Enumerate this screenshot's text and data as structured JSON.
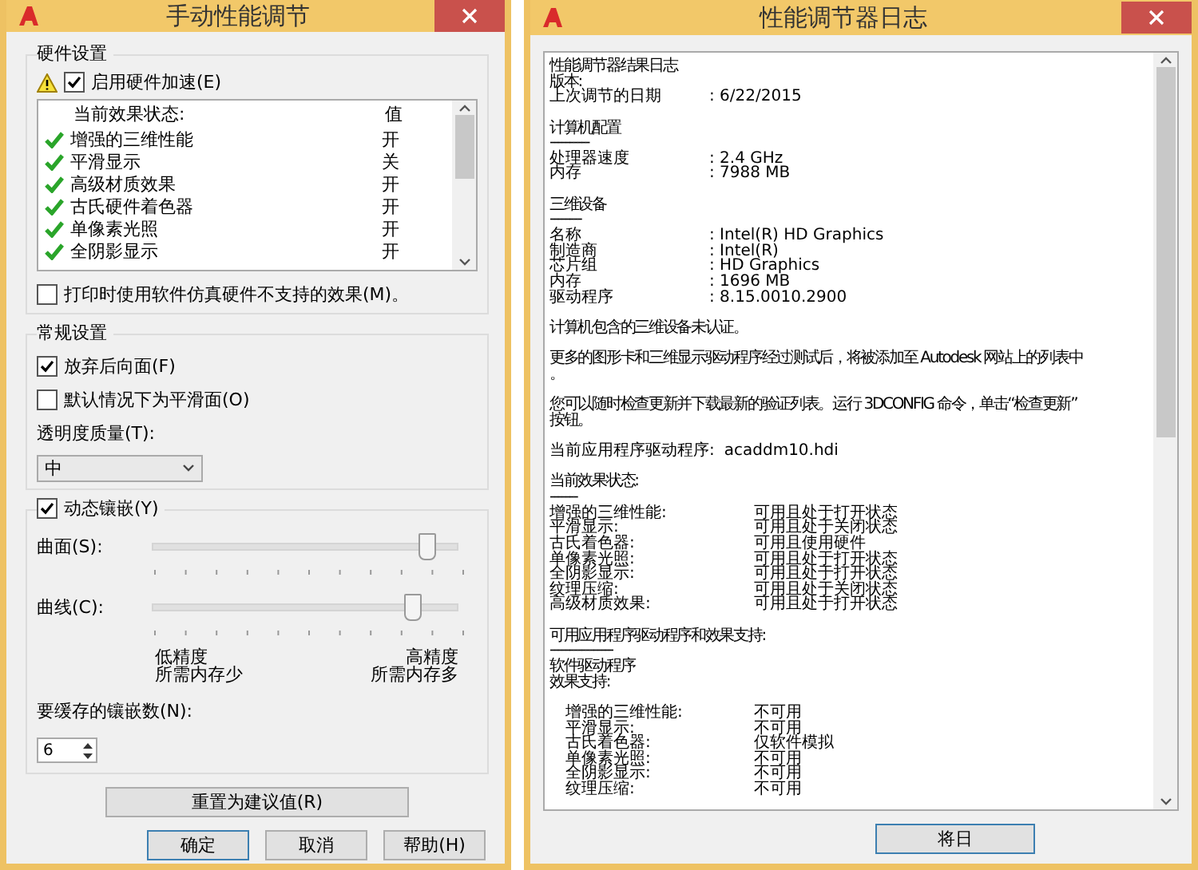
{
  "perf_dialog": {
    "title": "手动性能调节",
    "hardware": {
      "legend": "硬件设置",
      "accel": {
        "label": "启用硬件加速(E)",
        "checked": true
      },
      "effects": {
        "columns": [
          "当前效果状态:",
          "值"
        ],
        "rows": [
          {
            "name": "增强的三维性能",
            "value": "开"
          },
          {
            "name": "平滑显示",
            "value": "关"
          },
          {
            "name": "高级材质效果",
            "value": "开"
          },
          {
            "name": "古氏硬件着色器",
            "value": "开"
          },
          {
            "name": "单像素光照",
            "value": "开"
          },
          {
            "name": "全阴影显示",
            "value": "开"
          }
        ]
      },
      "emulate": {
        "label": "打印时使用软件仿真硬件不支持的效果(M)。",
        "checked": false
      }
    },
    "general": {
      "legend": "常规设置",
      "options": [
        {
          "label": "放弃后向面(F)",
          "checked": true
        },
        {
          "label": "默认情况下为平滑面(O)",
          "checked": false
        }
      ],
      "transparency": {
        "label": "透明度质量(T):",
        "value": "中"
      }
    },
    "tessellation": {
      "legend": {
        "label": "动态镶嵌(Y)",
        "checked": true
      },
      "sliders": [
        {
          "label": "曲面(S):",
          "level": 0.9
        },
        {
          "label": "曲线(C):",
          "level": 0.85
        }
      ],
      "low": [
        "低精度",
        "所需内存少"
      ],
      "high": [
        "高精度",
        "所需内存多"
      ],
      "cache": {
        "label": "要缓存的镶嵌数(N):",
        "value": "6"
      }
    },
    "reset_button": "重置为建议值(R)",
    "buttons": [
      {
        "label": "确定",
        "default": true
      },
      {
        "label": "取消",
        "default": false
      },
      {
        "label": "帮助(H)",
        "default": false
      }
    ]
  },
  "log_window": {
    "title": "性能调节器日志",
    "lines": [
      {
        "kind": "text",
        "text": "性能调节器结果日志"
      },
      {
        "kind": "text",
        "text": "版本:"
      },
      {
        "kind": "pair",
        "label": "上次调节的日期",
        "value": ": 6/22/2015"
      },
      {
        "kind": "blank"
      },
      {
        "kind": "text",
        "text": "计算机配置"
      },
      {
        "kind": "text",
        "text": "----------"
      },
      {
        "kind": "pair",
        "label": "处理器速度",
        "value": ": 2.4 GHz"
      },
      {
        "kind": "pair",
        "label": "内存",
        "value": ": 7988 MB"
      },
      {
        "kind": "blank"
      },
      {
        "kind": "text",
        "text": "三维设备"
      },
      {
        "kind": "text",
        "text": "--------"
      },
      {
        "kind": "pair",
        "label": "名称",
        "value": ": Intel(R) HD Graphics"
      },
      {
        "kind": "pair",
        "label": "制造商",
        "value": ": Intel(R)"
      },
      {
        "kind": "pair",
        "label": "芯片组",
        "value": ": HD Graphics"
      },
      {
        "kind": "pair",
        "label": "内存",
        "value": ": 1696 MB"
      },
      {
        "kind": "pair",
        "label": "驱动程序",
        "value": ": 8.15.0010.2900"
      },
      {
        "kind": "blank"
      },
      {
        "kind": "text",
        "text": "计算机包含的三维设备未认证。"
      },
      {
        "kind": "blank"
      },
      {
        "kind": "text",
        "text": "更多的图形卡和三维显示驱动程序经过测试后，将被添加至 Autodesk 网站上的列表中"
      },
      {
        "kind": "text",
        "text": "。"
      },
      {
        "kind": "blank"
      },
      {
        "kind": "text",
        "text": "您可以随时检查更新并下载最新的验证列表。运行 3DCONFIG 命令，单击“检查更新”"
      },
      {
        "kind": "text",
        "text": "按钮。"
      },
      {
        "kind": "blank"
      },
      {
        "kind": "pair",
        "label": "当前应用程序驱动程序:",
        "value": "acaddm10.hdi"
      },
      {
        "kind": "blank"
      },
      {
        "kind": "text",
        "text": "当前效果状态:"
      },
      {
        "kind": "text",
        "text": "-------"
      },
      {
        "kind": "pair2",
        "label": "增强的三维性能:",
        "value": "可用且处于打开状态"
      },
      {
        "kind": "pair2",
        "label": "平滑显示:",
        "value": "可用且处于关闭状态"
      },
      {
        "kind": "pair2",
        "label": "古氏着色器:",
        "value": "可用且使用硬件"
      },
      {
        "kind": "pair2",
        "label": "单像素光照:",
        "value": "可用且处于打开状态"
      },
      {
        "kind": "pair2",
        "label": "全阴影显示:",
        "value": "可用且处于打开状态"
      },
      {
        "kind": "pair2",
        "label": "纹理压缩:",
        "value": "可用且处于关闭状态"
      },
      {
        "kind": "pair2",
        "label": "高级材质效果:",
        "value": "可用且处于打开状态"
      },
      {
        "kind": "blank"
      },
      {
        "kind": "text",
        "text": "可用应用程序驱动程序和效果支持:"
      },
      {
        "kind": "text",
        "text": "----------------"
      },
      {
        "kind": "text",
        "text": "软件驱动程序"
      },
      {
        "kind": "text",
        "text": "效果支持:"
      },
      {
        "kind": "blank"
      },
      {
        "kind": "indent",
        "label": "增强的三维性能:",
        "value": "不可用"
      },
      {
        "kind": "indent",
        "label": "平滑显示:",
        "value": "不可用"
      },
      {
        "kind": "indent",
        "label": "古氏着色器:",
        "value": "仅软件模拟"
      },
      {
        "kind": "indent",
        "label": "单像素光照:",
        "value": "不可用"
      },
      {
        "kind": "indent",
        "label": "全阴影显示:",
        "value": "不可用"
      },
      {
        "kind": "indent",
        "label": "纹理压缩:",
        "value": "不可用"
      }
    ],
    "buttons": [
      {
        "label": "将日"
      }
    ]
  }
}
